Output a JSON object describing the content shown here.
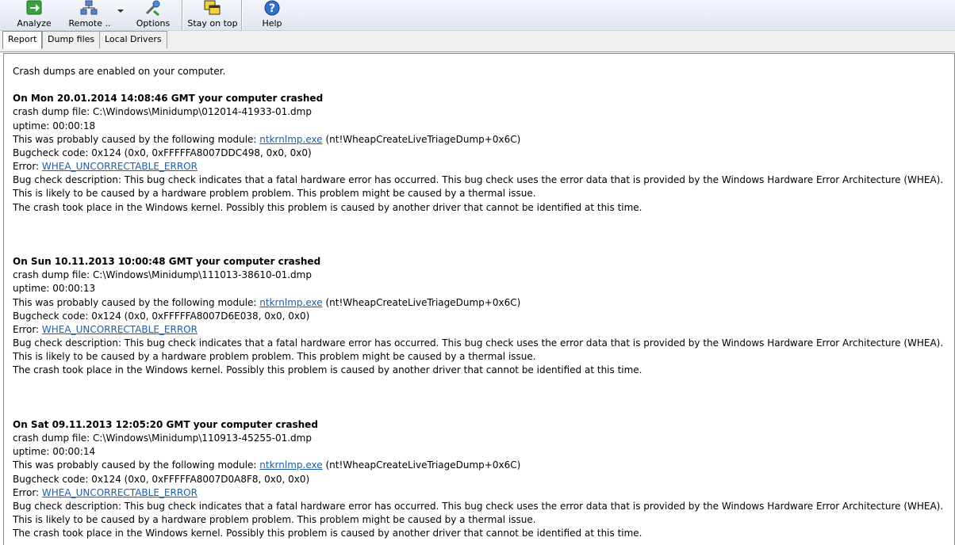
{
  "toolbar": {
    "analyze_label": "Analyze",
    "analyze_accel": "A",
    "remote_label": "Remote ..",
    "remote_accel": "R",
    "options_label": "Options",
    "options_accel": "O",
    "stay_on_top_label": "Stay on top",
    "stay_on_top_accel": "S",
    "help_label": "Help",
    "help_accel": "H"
  },
  "tabs": [
    {
      "label": "Report"
    },
    {
      "label": "Dump files"
    },
    {
      "label": "Local Drivers"
    }
  ],
  "report": {
    "intro": "Crash dumps are enabled on your computer.",
    "crashes": [
      {
        "title": "On Mon 20.01.2014 14:08:46 GMT your computer crashed",
        "dump_file": "crash dump file: C:\\Windows\\Minidump\\012014-41933-01.dmp",
        "uptime": "uptime: 00:00:18",
        "module_prefix": "This was probably caused by the following module: ",
        "module_link": "ntkrnlmp.exe",
        "module_suffix": " (nt!WheapCreateLiveTriageDump+0x6C)",
        "bugcheck": "Bugcheck code: 0x124 (0x0, 0xFFFFFA8007DDC498, 0x0, 0x0)",
        "error_prefix": "Error: ",
        "error_link": "WHEA_UNCORRECTABLE_ERROR",
        "description": "Bug check description: This bug check indicates that a fatal hardware error has occurred. This bug check uses the error data that is provided by the Windows Hardware Error Architecture (WHEA).",
        "likely": "This is likely to be caused by a hardware problem problem. This problem might be caused by a thermal issue.",
        "kernel": "The crash took place in the Windows kernel. Possibly this problem is caused by another driver that cannot be identified at this time."
      },
      {
        "title": "On Sun 10.11.2013 10:00:48 GMT your computer crashed",
        "dump_file": "crash dump file: C:\\Windows\\Minidump\\111013-38610-01.dmp",
        "uptime": "uptime: 00:00:13",
        "module_prefix": "This was probably caused by the following module: ",
        "module_link": "ntkrnlmp.exe",
        "module_suffix": " (nt!WheapCreateLiveTriageDump+0x6C)",
        "bugcheck": "Bugcheck code: 0x124 (0x0, 0xFFFFFA8007D6E038, 0x0, 0x0)",
        "error_prefix": "Error: ",
        "error_link": "WHEA_UNCORRECTABLE_ERROR",
        "description": "Bug check description: This bug check indicates that a fatal hardware error has occurred. This bug check uses the error data that is provided by the Windows Hardware Error Architecture (WHEA).",
        "likely": "This is likely to be caused by a hardware problem problem. This problem might be caused by a thermal issue.",
        "kernel": "The crash took place in the Windows kernel. Possibly this problem is caused by another driver that cannot be identified at this time."
      },
      {
        "title": "On Sat 09.11.2013 12:05:20 GMT your computer crashed",
        "dump_file": "crash dump file: C:\\Windows\\Minidump\\110913-45255-01.dmp",
        "uptime": "uptime: 00:00:14",
        "module_prefix": "This was probably caused by the following module: ",
        "module_link": "ntkrnlmp.exe",
        "module_suffix": " (nt!WheapCreateLiveTriageDump+0x6C)",
        "bugcheck": "Bugcheck code: 0x124 (0x0, 0xFFFFFA8007D0A8F8, 0x0, 0x0)",
        "error_prefix": "Error: ",
        "error_link": "WHEA_UNCORRECTABLE_ERROR",
        "description": "Bug check description: This bug check indicates that a fatal hardware error has occurred. This bug check uses the error data that is provided by the Windows Hardware Error Architecture (WHEA).",
        "likely": "This is likely to be caused by a hardware problem problem. This problem might be caused by a thermal issue.",
        "kernel": "The crash took place in the Windows kernel. Possibly this problem is caused by another driver that cannot be identified at this time."
      }
    ]
  },
  "colors": {
    "link": "#1a5fb4",
    "toolbar_top": "#f4f6fb",
    "toolbar_bottom": "#dfe5f1"
  },
  "icons": [
    "analyze-arrow-icon",
    "remote-network-icon",
    "options-tools-icon",
    "stay-on-top-windows-icon",
    "help-icon"
  ]
}
